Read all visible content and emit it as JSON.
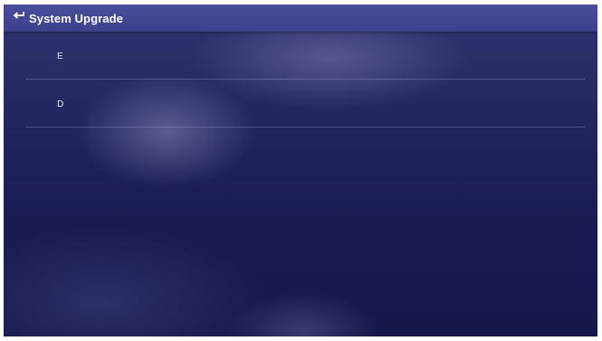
{
  "header": {
    "title": "System Upgrade",
    "back_icon": "return-arrow-icon"
  },
  "drives": [
    {
      "label": "E"
    },
    {
      "label": "D"
    }
  ],
  "colors": {
    "titlebar": "#4a4e9a",
    "background": "#1a1d55",
    "text": "#ffffff"
  }
}
